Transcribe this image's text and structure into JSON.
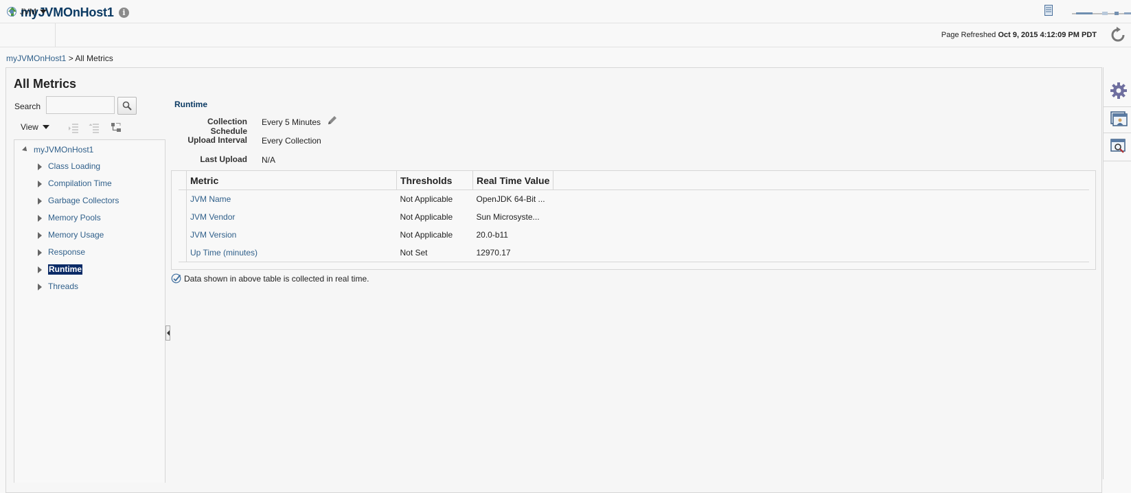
{
  "header": {
    "title": "myJVMOnHost1",
    "info_glyph": "i",
    "status_color": "#4a9a3a"
  },
  "menubar": {
    "target_menu_label": "JVM",
    "refresh_prefix": "Page Refreshed",
    "refresh_time": "Oct 9, 2015 4:12:09 PM PDT"
  },
  "breadcrumb": {
    "root": "myJVMOnHost1",
    "separator": ">",
    "current": "All Metrics"
  },
  "page": {
    "title": "All Metrics"
  },
  "left": {
    "search_label": "Search",
    "search_value": "",
    "view_label": "View",
    "tree": {
      "root": "myJVMOnHost1",
      "items": [
        {
          "label": "Class Loading",
          "selected": false
        },
        {
          "label": "Compilation Time",
          "selected": false
        },
        {
          "label": "Garbage Collectors",
          "selected": false
        },
        {
          "label": "Memory Pools",
          "selected": false
        },
        {
          "label": "Memory Usage",
          "selected": false
        },
        {
          "label": "Response",
          "selected": false
        },
        {
          "label": "Runtime",
          "selected": true
        },
        {
          "label": "Threads",
          "selected": false
        }
      ]
    }
  },
  "content": {
    "section_title": "Runtime",
    "properties": [
      {
        "label": "Collection Schedule",
        "value": "Every 5 Minutes"
      },
      {
        "label": "Upload Interval",
        "value": "Every Collection"
      },
      {
        "label": "Last Upload",
        "value": "N/A"
      }
    ],
    "table": {
      "headers": [
        "Metric",
        "Thresholds",
        "Real Time Value"
      ],
      "rows": [
        {
          "metric": "JVM Name",
          "thresholds": "Not Applicable",
          "value": "OpenJDK 64-Bit ..."
        },
        {
          "metric": "JVM Vendor",
          "thresholds": "Not Applicable",
          "value": "Sun Microsyste..."
        },
        {
          "metric": "JVM Version",
          "thresholds": "Not Applicable",
          "value": "20.0-b11"
        },
        {
          "metric": "Up Time (minutes)",
          "thresholds": "Not Set",
          "value": "12970.17"
        }
      ]
    },
    "note": "Data shown in above table is collected in real time."
  },
  "colors": {
    "link": "#2f5f8a",
    "title": "#0b3a63",
    "selected_bg": "#0a2a66",
    "rail_icon": "#6f6f9f"
  }
}
